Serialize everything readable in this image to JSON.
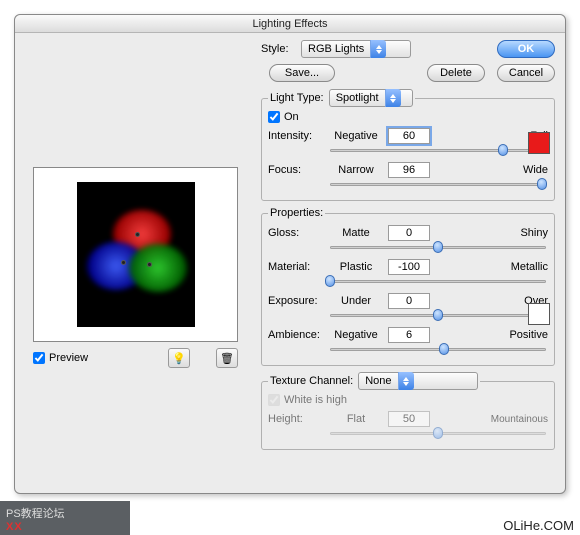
{
  "title": "Lighting Effects",
  "buttons": {
    "ok": "OK",
    "cancel": "Cancel",
    "save": "Save...",
    "delete": "Delete"
  },
  "style": {
    "label": "Style:",
    "value": "RGB Lights"
  },
  "lightType": {
    "legend": "Light Type:",
    "value": "Spotlight",
    "on": {
      "label": "On",
      "checked": true
    },
    "intensity": {
      "label": "Intensity:",
      "lo": "Negative",
      "hi": "Full",
      "value": "60",
      "pct": 80
    },
    "focus": {
      "label": "Focus:",
      "lo": "Narrow",
      "hi": "Wide",
      "value": "96",
      "pct": 98
    },
    "color": "#e81a1a"
  },
  "properties": {
    "legend": "Properties:",
    "gloss": {
      "label": "Gloss:",
      "lo": "Matte",
      "hi": "Shiny",
      "value": "0",
      "pct": 50
    },
    "material": {
      "label": "Material:",
      "lo": "Plastic",
      "hi": "Metallic",
      "value": "-100",
      "pct": 0
    },
    "exposure": {
      "label": "Exposure:",
      "lo": "Under",
      "hi": "Over",
      "value": "0",
      "pct": 50
    },
    "ambience": {
      "label": "Ambience:",
      "lo": "Negative",
      "hi": "Positive",
      "value": "6",
      "pct": 53
    },
    "color": "#ffffff"
  },
  "texture": {
    "legend": "Texture Channel:",
    "value": "None",
    "white": {
      "label": "White is high",
      "checked": true
    },
    "height": {
      "label": "Height:",
      "lo": "Flat",
      "hi": "Mountainous",
      "value": "50",
      "pct": 50
    }
  },
  "preview": {
    "label": "Preview",
    "checked": true,
    "bulbIcon": "bulb-icon",
    "trashIcon": "trash-icon"
  },
  "footer": {
    "left1": "PS教程论坛",
    "left2": "XX",
    "right": "OLiHe.COM"
  }
}
